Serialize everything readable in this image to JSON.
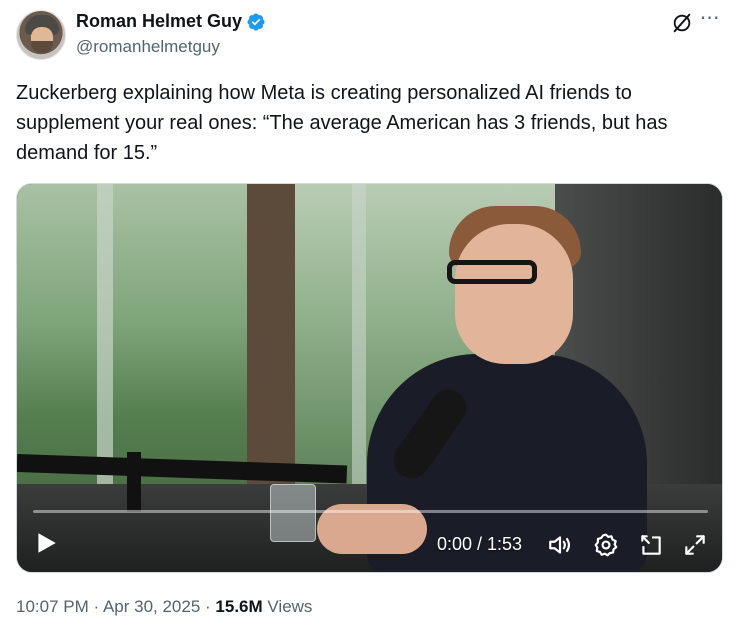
{
  "author": {
    "display_name": "Roman Helmet Guy",
    "handle": "@romanhelmetguy",
    "verified": true,
    "verified_color": "#1d9bf0"
  },
  "tweet": {
    "text": "Zuckerberg explaining how Meta is creating personalized AI friends to supplement your real ones: “The average American has 3 friends, but has demand for 15.”"
  },
  "video": {
    "current_time": "0:00",
    "duration": "1:53",
    "time_display": "0:00 / 1:53",
    "progress_fraction": 0.0,
    "controls": [
      "play-icon",
      "volume-icon",
      "settings-icon",
      "pip-icon",
      "fullscreen-icon"
    ]
  },
  "meta": {
    "time": "10:07 PM",
    "separator": " · ",
    "date": "Apr 30, 2025",
    "views_count": "15.6M",
    "views_label": " Views"
  },
  "colors": {
    "text_primary": "#0f1419",
    "text_secondary": "#536471",
    "accent": "#1d9bf0"
  }
}
